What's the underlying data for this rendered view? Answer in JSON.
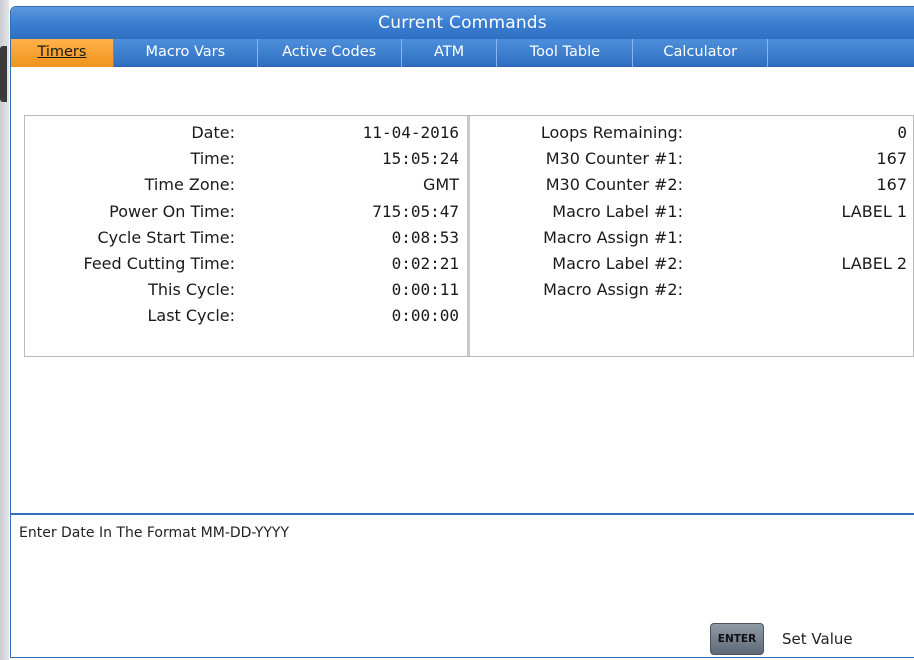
{
  "window": {
    "title": "Current Commands"
  },
  "tabs": [
    {
      "label": "Timers",
      "active": true
    },
    {
      "label": "Macro Vars",
      "active": false
    },
    {
      "label": "Active Codes",
      "active": false
    },
    {
      "label": "ATM",
      "active": false
    },
    {
      "label": "Tool Table",
      "active": false
    },
    {
      "label": "Calculator",
      "active": false
    },
    {
      "label": "",
      "active": false
    }
  ],
  "timers": [
    {
      "label": "Date:",
      "value": "11-04-2016"
    },
    {
      "label": "Time:",
      "value": "15:05:24"
    },
    {
      "label": "Time Zone:",
      "value": "GMT"
    },
    {
      "label": "Power On Time:",
      "value": "715:05:47"
    },
    {
      "label": "Cycle Start Time:",
      "value": "0:08:53"
    },
    {
      "label": "Feed Cutting Time:",
      "value": "0:02:21"
    },
    {
      "label": "This Cycle:",
      "value": "0:00:11"
    },
    {
      "label": "Last Cycle:",
      "value": "0:00:00"
    }
  ],
  "counters": [
    {
      "label": "Loops Remaining:",
      "value": "0"
    },
    {
      "label": "M30 Counter #1:",
      "value": "167"
    },
    {
      "label": "M30 Counter #2:",
      "value": "167"
    },
    {
      "label": "Macro Label #1:",
      "value": "LABEL 1"
    },
    {
      "label": "Macro Assign #1:",
      "value": ""
    },
    {
      "label": "Macro Label #2:",
      "value": "LABEL 2"
    },
    {
      "label": "Macro Assign #2:",
      "value": ""
    }
  ],
  "help": {
    "text": "Enter Date In The Format MM-DD-YYYY"
  },
  "footer": {
    "enter_key": "ENTER",
    "enter_action": "Set Value"
  },
  "colors": {
    "title_bar": "#3b7fd2",
    "active_tab": "#f0931a",
    "border": "#2f6fba"
  }
}
